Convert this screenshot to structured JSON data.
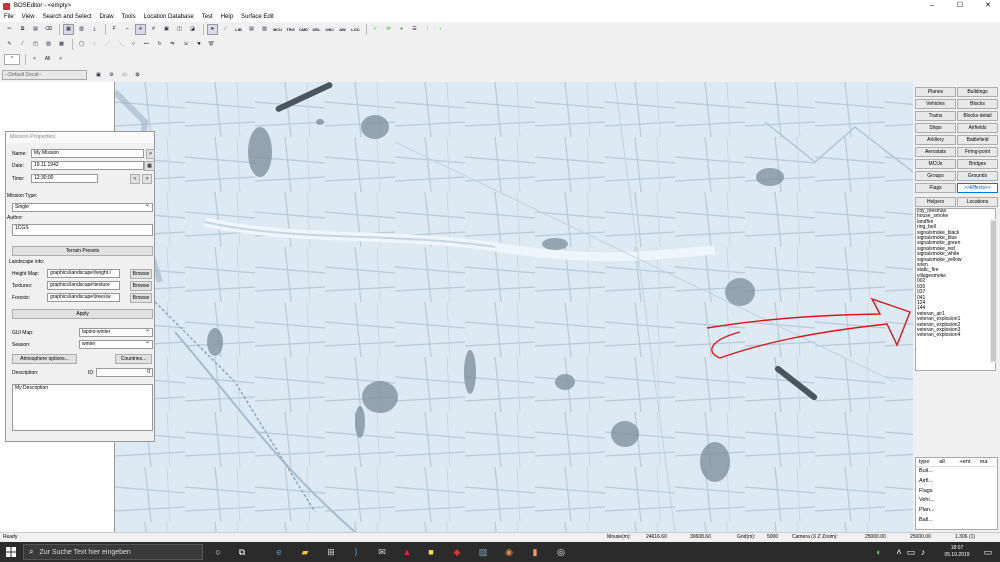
{
  "window": {
    "title": "BOSEditor - <empty>",
    "minimize": "–",
    "maximize": "☐",
    "close": "✕"
  },
  "menu": [
    "File",
    "View",
    "Search and Select",
    "Draw",
    "Tools",
    "Location Database",
    "Test",
    "Help",
    "Surface Edit"
  ],
  "toolbar": {
    "loc_label": "LOC",
    "decal_select": "--Default Decal--"
  },
  "mission_properties": {
    "title": "Mission Properties",
    "name_label": "Name:",
    "name_value": "My Mission",
    "name_btn": ">",
    "date_label": "Date:",
    "date_value": "19.11.1942",
    "time_label": "Time:",
    "time_value": "12:30:00",
    "prev_btn": "<",
    "next_btn": ">",
    "mission_type_label": "Mission Type:",
    "mission_type_value": "Single",
    "author_label": "Author:",
    "author_value": "1CGS",
    "terrain_presets": "Terrain Presets",
    "landscape_label": "Landscape info:",
    "heightmap_label": "Height Map:",
    "heightmap_value": "graphics\\landscape\\height.l",
    "textures_label": "Textures:",
    "textures_value": "graphics\\landscape\\texture",
    "forests_label": "Forests:",
    "forests_value": "graphics\\landscape\\trees\\w",
    "browse": "Browse",
    "apply": "Apply",
    "gui_map_label": "GUI Map:",
    "gui_map_value": "lapino-winter",
    "season_label": "Season:",
    "season_value": "winter",
    "atmosphere_btn": "Atmosphere options...",
    "countries_btn": "Countries...",
    "description_label": "Description:",
    "id_label": "ID:",
    "id_value": "0",
    "description_value": "My Description"
  },
  "categories": {
    "left": [
      "Planes",
      "Vehicles",
      "Trains",
      "Ships",
      "Artillery",
      "Aerostats",
      "MCUs",
      "Groups",
      "Flags"
    ],
    "right": [
      "Buildings",
      "Blocks",
      "Blocks-detail",
      "Airfields",
      "Battlefield",
      "Firing-point",
      "Bridges",
      "Grounds",
      ">>Effects<<"
    ],
    "selected": ">>Effects<<",
    "helpers": "Helpers",
    "locations": "Locations"
  },
  "effects_list": [
    "city_firesmall",
    "house_smoke",
    "landfire",
    "ring_bell",
    "signalsmoke_black",
    "signalsmoke_blue",
    "signalsmoke_green",
    "signalsmoke_red",
    "signalsmoke_white",
    "signalsmoke_yellow",
    "siren",
    "static_fire",
    "villagesmoke",
    "002",
    "030",
    "037",
    "041",
    "124",
    "144",
    "veteran_air1",
    "veteran_explosion1",
    "veteran_explosion2",
    "veteran_explosion3",
    "veteran_explosion4"
  ],
  "lower_list": {
    "headers": [
      "type",
      "all",
      "+ent",
      "ma"
    ],
    "rows": [
      "Buil...",
      "Airfi...",
      "Flags",
      "Vehi...",
      "Plan...",
      "Ball..."
    ]
  },
  "status": {
    "ready": "Ready",
    "mouse_label": "Mouse(m):",
    "mouse_x": "24616.60",
    "mouse_z": "30608.60",
    "grid_label": "Grid(m):",
    "grid_value": "5000",
    "camera_label": "Camera (X Z Zoom):",
    "camera_x": "25000.00",
    "camera_z": "25000.00",
    "zoom_value": "1.306 (1)"
  },
  "taskbar": {
    "search_placeholder": "Zur Suche Text hier eingeben",
    "time": "18:07",
    "date": "05.10.2019"
  },
  "colors": {
    "accent": "#0078d7",
    "annotation": "#d81818",
    "map_snow": "#dce8f2"
  }
}
